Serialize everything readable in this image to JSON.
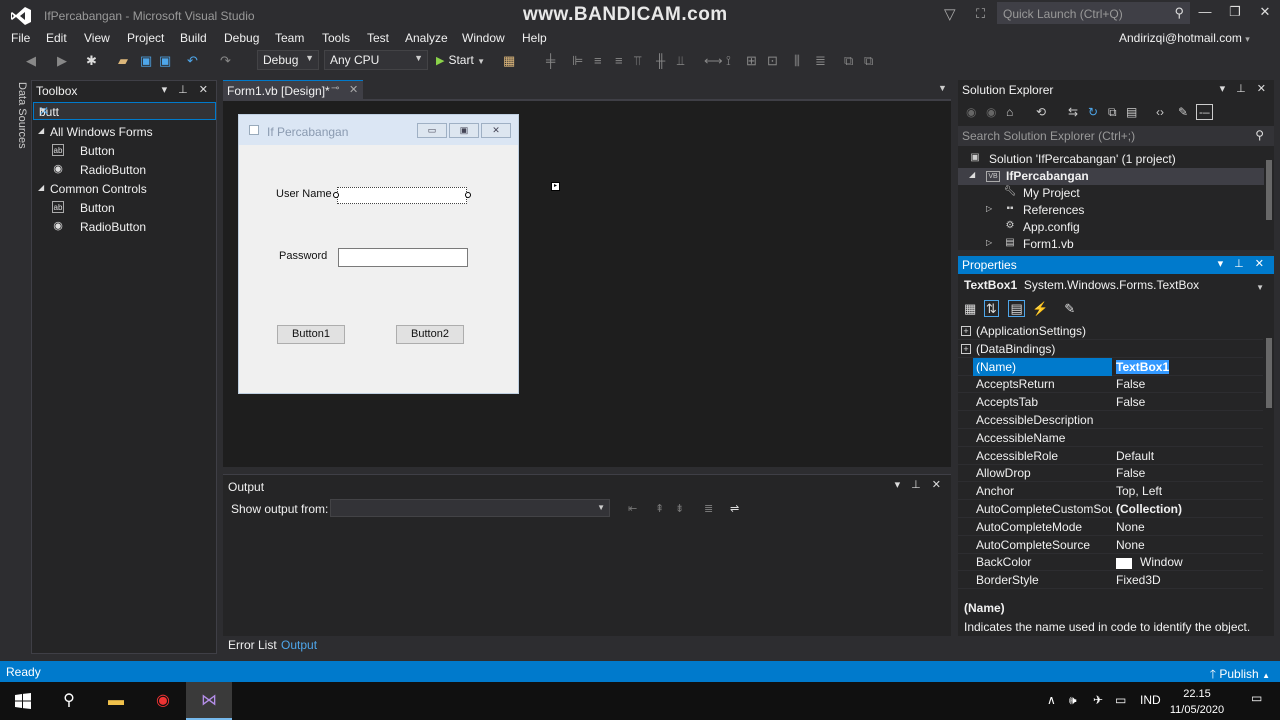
{
  "window": {
    "title": "IfPercabangan - Microsoft Visual Studio",
    "watermark": "www.BANDICAM.com",
    "quick_launch_placeholder": "Quick Launch (Ctrl+Q)"
  },
  "menu": [
    "File",
    "Edit",
    "View",
    "Project",
    "Build",
    "Debug",
    "Team",
    "Tools",
    "Test",
    "Analyze",
    "Window",
    "Help"
  ],
  "account": "Andirizqi@hotmail.com",
  "toolbar": {
    "config": "Debug",
    "platform": "Any CPU",
    "start": "Start"
  },
  "side_tab": "Data Sources",
  "toolbox": {
    "title": "Toolbox",
    "search_value": "butt",
    "groups": [
      {
        "name": "All Windows Forms",
        "items": [
          "Button",
          "RadioButton"
        ]
      },
      {
        "name": "Common Controls",
        "items": [
          "Button",
          "RadioButton"
        ]
      }
    ]
  },
  "designer": {
    "tab_label": "Form1.vb [Design]*",
    "form_title": "If Percabangan",
    "label_username": "User Name",
    "label_password": "Password",
    "button1": "Button1",
    "button2": "Button2"
  },
  "output": {
    "title": "Output",
    "show_from_label": "Show output from:",
    "tabs": [
      "Error List",
      "Output"
    ]
  },
  "solution_explorer": {
    "title": "Solution Explorer",
    "search_placeholder": "Search Solution Explorer (Ctrl+;)",
    "items": [
      {
        "label": "Solution 'IfPercabangan' (1 project)"
      },
      {
        "label": "IfPercabangan"
      },
      {
        "label": "My Project"
      },
      {
        "label": "References"
      },
      {
        "label": "App.config"
      },
      {
        "label": "Form1.vb"
      }
    ]
  },
  "properties": {
    "title": "Properties",
    "object_name": "TextBox1",
    "object_type": "System.Windows.Forms.TextBox",
    "rows": [
      {
        "name": "(ApplicationSettings)",
        "value": ""
      },
      {
        "name": "(DataBindings)",
        "value": ""
      },
      {
        "name": "(Name)",
        "value": "TextBox1"
      },
      {
        "name": "AcceptsReturn",
        "value": "False"
      },
      {
        "name": "AcceptsTab",
        "value": "False"
      },
      {
        "name": "AccessibleDescription",
        "value": ""
      },
      {
        "name": "AccessibleName",
        "value": ""
      },
      {
        "name": "AccessibleRole",
        "value": "Default"
      },
      {
        "name": "AllowDrop",
        "value": "False"
      },
      {
        "name": "Anchor",
        "value": "Top, Left"
      },
      {
        "name": "AutoCompleteCustomSour",
        "value": "(Collection)"
      },
      {
        "name": "AutoCompleteMode",
        "value": "None"
      },
      {
        "name": "AutoCompleteSource",
        "value": "None"
      },
      {
        "name": "BackColor",
        "value": "Window"
      },
      {
        "name": "BorderStyle",
        "value": "Fixed3D"
      }
    ],
    "desc_title": "(Name)",
    "desc_text": "Indicates the name used in code to identify the object."
  },
  "status": {
    "left": "Ready",
    "right": "Publish"
  },
  "taskbar": {
    "language": "IND",
    "time": "22.15",
    "date": "11/05/2020"
  }
}
